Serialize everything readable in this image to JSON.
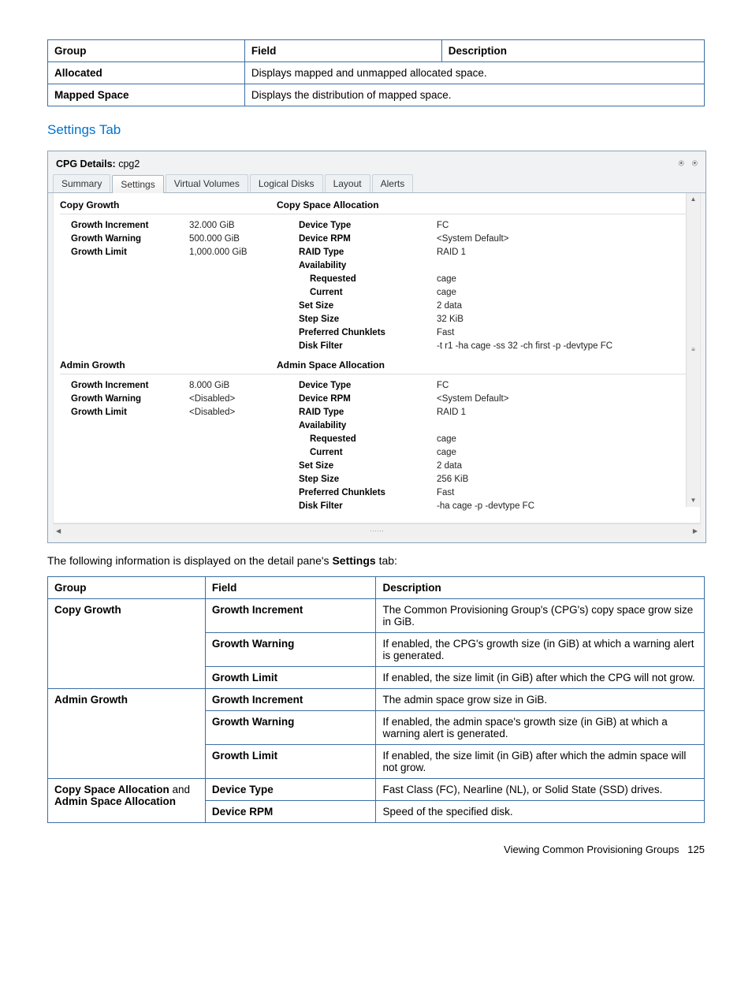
{
  "table1": {
    "headers": [
      "Group",
      "Field",
      "Description"
    ],
    "rows": [
      {
        "group": "Allocated",
        "combined": "Displays mapped and unmapped allocated space."
      },
      {
        "group": "Mapped Space",
        "combined": "Displays the distribution of mapped space."
      }
    ]
  },
  "settings_heading": "Settings Tab",
  "panel": {
    "title_prefix": "CPG Details: ",
    "title_name": "cpg2",
    "tabs": [
      "Summary",
      "Settings",
      "Virtual Volumes",
      "Logical Disks",
      "Layout",
      "Alerts"
    ],
    "copy_growth": {
      "heading": "Copy Growth",
      "growth_increment_label": "Growth Increment",
      "growth_increment_value": "32.000 GiB",
      "growth_warning_label": "Growth Warning",
      "growth_warning_value": "500.000 GiB",
      "growth_limit_label": "Growth Limit",
      "growth_limit_value": "1,000.000 GiB"
    },
    "copy_space_alloc": {
      "heading": "Copy Space Allocation",
      "device_type_label": "Device Type",
      "device_type_value": "FC",
      "device_rpm_label": "Device RPM",
      "device_rpm_value": "<System Default>",
      "raid_type_label": "RAID Type",
      "raid_type_value": "RAID 1",
      "availability_label": "Availability",
      "requested_label": "Requested",
      "requested_value": "cage",
      "current_label": "Current",
      "current_value": "cage",
      "set_size_label": "Set Size",
      "set_size_value": "2 data",
      "step_size_label": "Step Size",
      "step_size_value": "32 KiB",
      "pref_chunk_label": "Preferred Chunklets",
      "pref_chunk_value": "Fast",
      "disk_filter_label": "Disk Filter",
      "disk_filter_value": "-t r1 -ha cage -ss 32 -ch first -p -devtype FC"
    },
    "admin_growth": {
      "heading": "Admin Growth",
      "growth_increment_label": "Growth Increment",
      "growth_increment_value": "8.000 GiB",
      "growth_warning_label": "Growth Warning",
      "growth_warning_value": "<Disabled>",
      "growth_limit_label": "Growth Limit",
      "growth_limit_value": "<Disabled>"
    },
    "admin_space_alloc": {
      "heading": "Admin Space Allocation",
      "device_type_label": "Device Type",
      "device_type_value": "FC",
      "device_rpm_label": "Device RPM",
      "device_rpm_value": "<System Default>",
      "raid_type_label": "RAID Type",
      "raid_type_value": "RAID 1",
      "availability_label": "Availability",
      "requested_label": "Requested",
      "requested_value": "cage",
      "current_label": "Current",
      "current_value": "cage",
      "set_size_label": "Set Size",
      "set_size_value": "2 data",
      "step_size_label": "Step Size",
      "step_size_value": "256 KiB",
      "pref_chunk_label": "Preferred Chunklets",
      "pref_chunk_value": "Fast",
      "disk_filter_label": "Disk Filter",
      "disk_filter_value": "-ha cage -p -devtype FC"
    }
  },
  "para_before_table2_a": "The following information is displayed on the detail pane's ",
  "para_before_table2_bold": "Settings",
  "para_before_table2_b": " tab:",
  "table2": {
    "headers": [
      "Group",
      "Field",
      "Description"
    ],
    "rows": [
      {
        "group": "Copy Growth",
        "field": "Growth Increment",
        "desc": "The Common Provisioning Group's (CPG's) copy space grow size in GiB."
      },
      {
        "group": "",
        "field": "Growth Warning",
        "desc": "If enabled, the CPG's growth size (in GiB) at which a warning alert is generated."
      },
      {
        "group": "",
        "field": "Growth Limit",
        "desc": "If enabled, the size limit (in GiB) after which the CPG will not grow."
      },
      {
        "group": "Admin Growth",
        "field": "Growth Increment",
        "desc": "The admin space grow size in GiB."
      },
      {
        "group": "",
        "field": "Growth Warning",
        "desc": "If enabled, the admin space's growth size (in GiB) at which a warning alert is generated."
      },
      {
        "group": "",
        "field": "Growth Limit",
        "desc": "If enabled, the size limit (in GiB) after which the admin space will not grow."
      },
      {
        "group_html": "Copy Space Allocation and Admin Space Allocation",
        "group_bold1": "Copy Space Allocation",
        "group_and": " and ",
        "group_bold2": "Admin Space Allocation",
        "field": "Device Type",
        "desc": "Fast Class (FC), Nearline (NL), or Solid State (SSD) drives."
      },
      {
        "group": "",
        "field": "Device RPM",
        "desc": "Speed of the specified disk."
      }
    ]
  },
  "footer_text": "Viewing Common Provisioning Groups",
  "footer_page": "125"
}
